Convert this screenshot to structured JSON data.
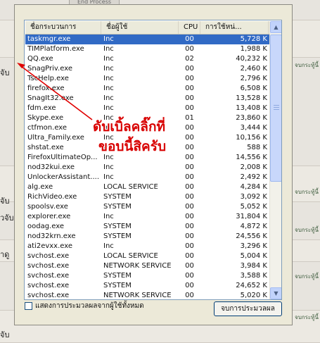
{
  "background": {
    "top_button_label": "End Process",
    "left_labels": [
      "จับ",
      "จับ",
      "วจับ",
      "าดู",
      "จับ"
    ],
    "right_labels": [
      "จบกระทู้นี้",
      "จบกระทู้นี้",
      "จบกระทู้นี้",
      "จบกระทู้นี้",
      "จบกระทู้นี้"
    ]
  },
  "columns": {
    "image_name": "ชื่อกระบวนการ",
    "user_name": "ชื่อผู้ใช้",
    "cpu": "CPU",
    "mem": "การใช้หน่..."
  },
  "processes": [
    {
      "name": "taskmgr.exe",
      "user": "Inc",
      "cpu": "00",
      "mem": "5,728 K",
      "selected": true
    },
    {
      "name": "TIMPlatform.exe",
      "user": "Inc",
      "cpu": "00",
      "mem": "1,988 K"
    },
    {
      "name": "QQ.exe",
      "user": "Inc",
      "cpu": "02",
      "mem": "40,232 K"
    },
    {
      "name": "SnagPriv.exe",
      "user": "Inc",
      "cpu": "00",
      "mem": "2,460 K"
    },
    {
      "name": "TscHelp.exe",
      "user": "Inc",
      "cpu": "00",
      "mem": "2,796 K"
    },
    {
      "name": "firefox.exe",
      "user": "Inc",
      "cpu": "00",
      "mem": "6,508 K"
    },
    {
      "name": "SnagIt32.exe",
      "user": "Inc",
      "cpu": "00",
      "mem": "13,528 K"
    },
    {
      "name": "fdm.exe",
      "user": "Inc",
      "cpu": "00",
      "mem": "13,408 K"
    },
    {
      "name": "Skype.exe",
      "user": "Inc",
      "cpu": "01",
      "mem": "23,860 K"
    },
    {
      "name": "ctfmon.exe",
      "user": "Inc",
      "cpu": "00",
      "mem": "3,444 K"
    },
    {
      "name": "Ultra_Family.exe",
      "user": "Inc",
      "cpu": "00",
      "mem": "10,156 K"
    },
    {
      "name": "shstat.exe",
      "user": "Inc",
      "cpu": "00",
      "mem": "588 K"
    },
    {
      "name": "FirefoxUltimateOp...",
      "user": "Inc",
      "cpu": "00",
      "mem": "14,556 K"
    },
    {
      "name": "nod32kui.exe",
      "user": "Inc",
      "cpu": "00",
      "mem": "2,008 K"
    },
    {
      "name": "UnlockerAssistant....",
      "user": "Inc",
      "cpu": "00",
      "mem": "2,492 K"
    },
    {
      "name": "alg.exe",
      "user": "LOCAL SERVICE",
      "cpu": "00",
      "mem": "4,284 K"
    },
    {
      "name": "RichVideo.exe",
      "user": "SYSTEM",
      "cpu": "00",
      "mem": "3,092 K"
    },
    {
      "name": "spoolsv.exe",
      "user": "SYSTEM",
      "cpu": "00",
      "mem": "5,052 K"
    },
    {
      "name": "explorer.exe",
      "user": "Inc",
      "cpu": "00",
      "mem": "31,804 K"
    },
    {
      "name": "oodag.exe",
      "user": "SYSTEM",
      "cpu": "00",
      "mem": "4,872 K"
    },
    {
      "name": "nod32krn.exe",
      "user": "SYSTEM",
      "cpu": "00",
      "mem": "24,556 K"
    },
    {
      "name": "ati2evxx.exe",
      "user": "Inc",
      "cpu": "00",
      "mem": "3,296 K"
    },
    {
      "name": "svchost.exe",
      "user": "LOCAL SERVICE",
      "cpu": "00",
      "mem": "5,004 K"
    },
    {
      "name": "svchost.exe",
      "user": "NETWORK SERVICE",
      "cpu": "00",
      "mem": "3,984 K"
    },
    {
      "name": "svchost.exe",
      "user": "SYSTEM",
      "cpu": "00",
      "mem": "3,588 K"
    },
    {
      "name": "svchost.exe",
      "user": "SYSTEM",
      "cpu": "00",
      "mem": "24,652 K"
    },
    {
      "name": "svchost.exe",
      "user": "NETWORK SERVICE",
      "cpu": "00",
      "mem": "5,020 K"
    }
  ],
  "footer": {
    "show_all_label": "แสดงการประมวลผลจากผู้ใช้ทั้งหมด",
    "end_process_label": "จบการประมวลผล"
  },
  "annotation": {
    "line1": "ดับเบิ้ลคลิ๊กที่",
    "line2": "ขอบนี้สิครับ",
    "color": "#d80000"
  },
  "colors": {
    "selection": "#316ac5",
    "dialog_bg": "#ece9d8"
  }
}
